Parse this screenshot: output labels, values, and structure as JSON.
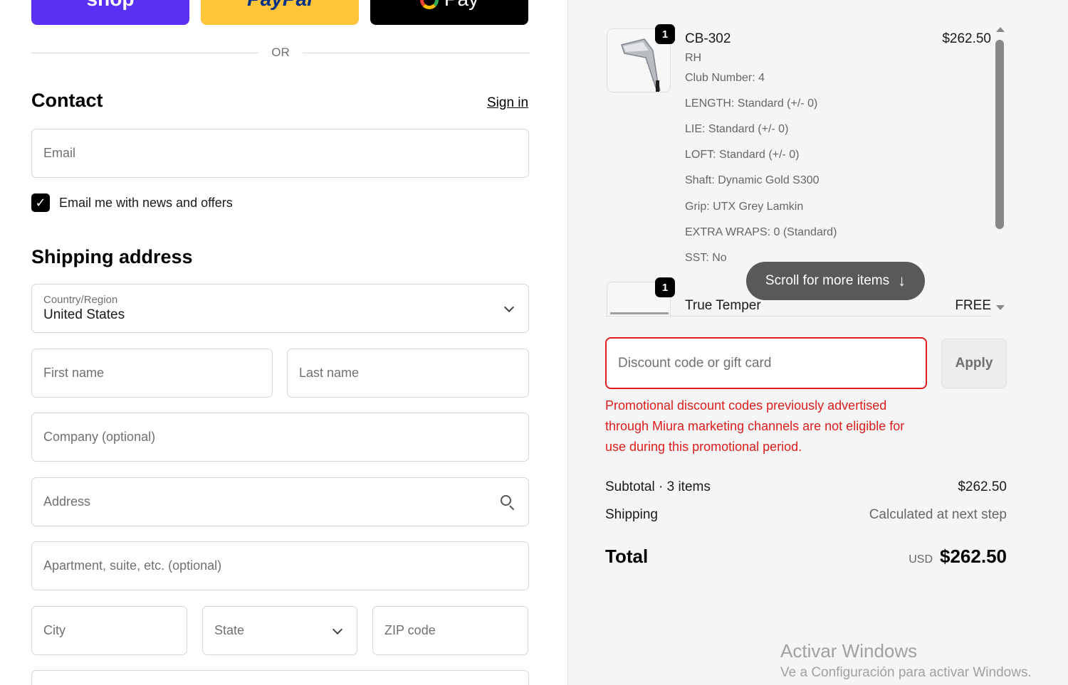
{
  "express": {
    "shop_label": "shop",
    "paypal_label": "PayPal",
    "gpay_label": "Pay"
  },
  "or_label": "OR",
  "contact": {
    "heading": "Contact",
    "sign_in": "Sign in",
    "email_placeholder": "Email",
    "newsletter_label": "Email me with news and offers",
    "newsletter_checked": true
  },
  "shipping": {
    "heading": "Shipping address",
    "country_label": "Country/Region",
    "country_value": "United States",
    "first_name_placeholder": "First name",
    "last_name_placeholder": "Last name",
    "company_placeholder": "Company (optional)",
    "address_placeholder": "Address",
    "apartment_placeholder": "Apartment, suite, etc. (optional)",
    "city_placeholder": "City",
    "state_label": "State",
    "zip_placeholder": "ZIP code"
  },
  "cart": {
    "items": [
      {
        "quantity": "1",
        "title": "CB-302",
        "price": "$262.50",
        "attributes": [
          "RH",
          "Club Number: 4",
          "LENGTH: Standard (+/- 0)",
          "LIE: Standard (+/- 0)",
          "LOFT: Standard (+/- 0)",
          "Shaft: Dynamic Gold S300",
          "Grip: UTX Grey Lamkin",
          "EXTRA WRAPS: 0 (Standard)",
          "SST: No"
        ]
      },
      {
        "quantity": "1",
        "title": "True Temper",
        "price": "FREE"
      }
    ],
    "scroll_hint": "Scroll for more items"
  },
  "discount": {
    "placeholder": "Discount code or gift card",
    "apply_label": "Apply",
    "error": "Promotional discount codes previously advertised through Miura marketing channels are not eligible for use during this promotional period."
  },
  "summary": {
    "subtotal_label": "Subtotal · 3 items",
    "subtotal_value": "$262.50",
    "shipping_label": "Shipping",
    "shipping_value": "Calculated at next step",
    "total_label": "Total",
    "currency": "USD",
    "total_value": "$262.50"
  },
  "watermark": {
    "title": "Activar Windows",
    "subtitle": "Ve a Configuración para activar Windows."
  },
  "colors": {
    "shop": "#5a31f4",
    "paypal": "#ffc439",
    "error": "#dd1d1d"
  }
}
